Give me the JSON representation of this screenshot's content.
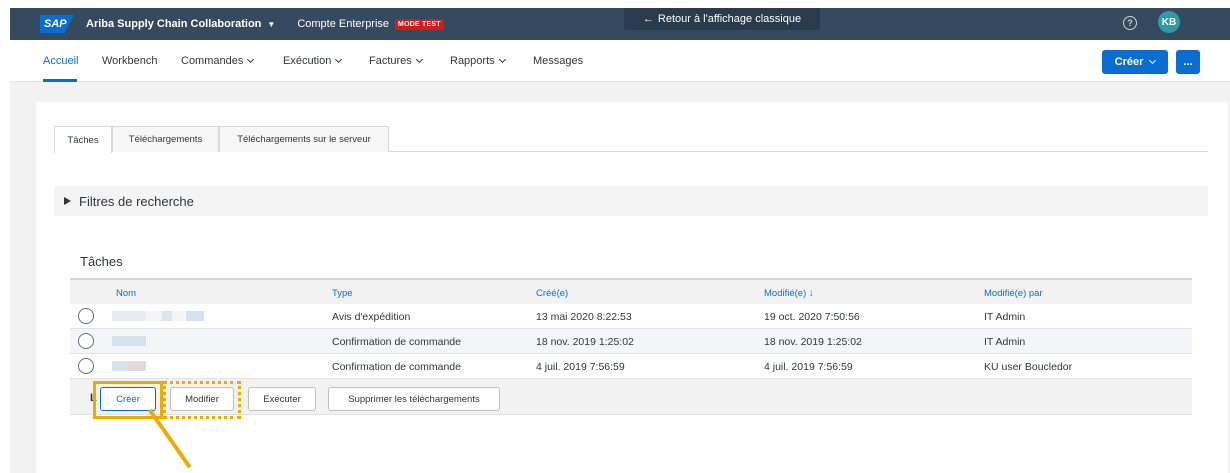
{
  "shell": {
    "logo": "SAP",
    "app_title": "Ariba Supply Chain Collaboration",
    "account": "Compte Enterprise",
    "mode_badge": "MODE TEST",
    "classic_view": "Retour à l'affichage classique",
    "help": "?",
    "avatar": "KB"
  },
  "nav": {
    "items": [
      "Accueil",
      "Workbench",
      "Commandes",
      "Exécution",
      "Factures",
      "Rapports",
      "Messages"
    ],
    "create_label": "Créer",
    "more_label": "..."
  },
  "tabs": [
    "Tâches",
    "Téléchargements",
    "Téléchargements sur le serveur"
  ],
  "filters": {
    "label": "Filtres de recherche"
  },
  "section_title": "Tâches",
  "table": {
    "columns": [
      "Nom",
      "Type",
      "Créé(e)",
      "Modifié(e) ↓",
      "Modifié(e) par"
    ],
    "rows": [
      {
        "type": "Avis d'expédition",
        "created": "13 mai 2020 8:22:53",
        "modified": "19 oct. 2020 7:50:56",
        "modified_by": "IT Admin"
      },
      {
        "type": "Confirmation de commande",
        "created": "18 nov. 2019 1:25:02",
        "modified": "18 nov. 2019 1:25:02",
        "modified_by": "IT Admin"
      },
      {
        "type": "Confirmation de commande",
        "created": "4 juil. 2019 7:56:59",
        "modified": "4 juil. 2019 7:56:59",
        "modified_by": "KU user Boucledor"
      }
    ]
  },
  "actions": {
    "letter": "L",
    "create": "Créer",
    "modify": "Modifier",
    "execute": "Exécuter",
    "delete_downloads": "Supprimer les téléchargements"
  },
  "colors": {
    "shell": "#354a5f",
    "accent": "#0a6ed1",
    "highlight": "#f0ab00",
    "badge": "#d11c1c"
  }
}
